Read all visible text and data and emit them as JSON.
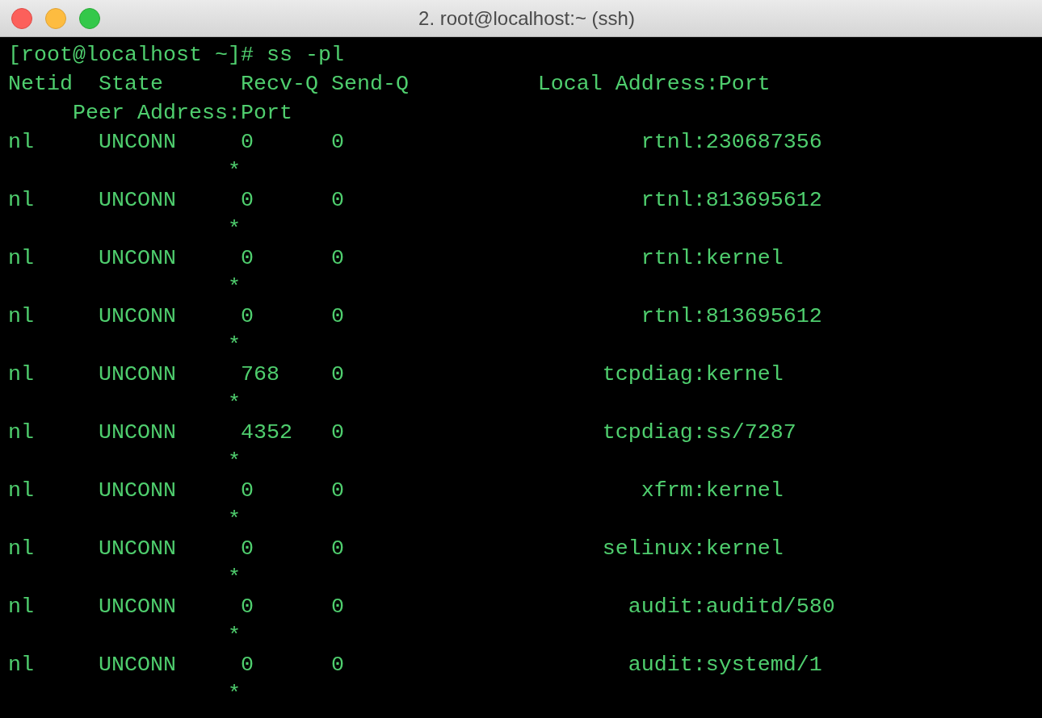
{
  "window": {
    "title": "2. root@localhost:~ (ssh)"
  },
  "terminal": {
    "prompt": "[root@localhost ~]# ss -pl",
    "header": [
      "Netid  State      Recv-Q Send-Q          Local Address:Port",
      "     Peer Address:Port"
    ],
    "rows": [
      {
        "netid": "nl",
        "state": "UNCONN",
        "recv_q": "0",
        "send_q": "0",
        "local": "rtnl:230687356",
        "peer": "*"
      },
      {
        "netid": "nl",
        "state": "UNCONN",
        "recv_q": "0",
        "send_q": "0",
        "local": "rtnl:813695612",
        "peer": "*"
      },
      {
        "netid": "nl",
        "state": "UNCONN",
        "recv_q": "0",
        "send_q": "0",
        "local": "rtnl:kernel",
        "peer": "*"
      },
      {
        "netid": "nl",
        "state": "UNCONN",
        "recv_q": "0",
        "send_q": "0",
        "local": "rtnl:813695612",
        "peer": "*"
      },
      {
        "netid": "nl",
        "state": "UNCONN",
        "recv_q": "768",
        "send_q": "0",
        "local": "tcpdiag:kernel",
        "peer": "*"
      },
      {
        "netid": "nl",
        "state": "UNCONN",
        "recv_q": "4352",
        "send_q": "0",
        "local": "tcpdiag:ss/7287",
        "peer": "*"
      },
      {
        "netid": "nl",
        "state": "UNCONN",
        "recv_q": "0",
        "send_q": "0",
        "local": "xfrm:kernel",
        "peer": "*"
      },
      {
        "netid": "nl",
        "state": "UNCONN",
        "recv_q": "0",
        "send_q": "0",
        "local": "selinux:kernel",
        "peer": "*"
      },
      {
        "netid": "nl",
        "state": "UNCONN",
        "recv_q": "0",
        "send_q": "0",
        "local": "audit:auditd/580",
        "peer": "*"
      },
      {
        "netid": "nl",
        "state": "UNCONN",
        "recv_q": "0",
        "send_q": "0",
        "local": "audit:systemd/1",
        "peer": "*"
      }
    ]
  }
}
